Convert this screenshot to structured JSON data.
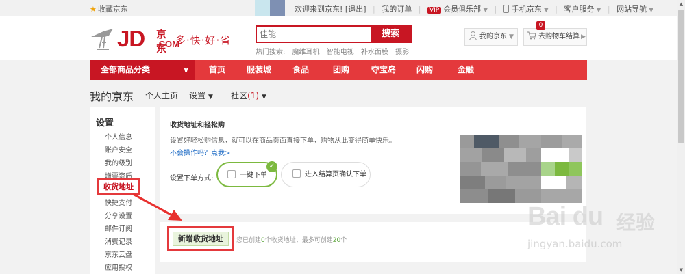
{
  "topbar": {
    "favorite": "收藏京东",
    "welcome": "欢迎来到京东! [退出]",
    "my_orders": "我的订单",
    "vip_badge": "VIP",
    "vip_club": "会员俱乐部",
    "mobile": "手机京东",
    "customer_service": "客户服务",
    "site_nav": "网站导航"
  },
  "header": {
    "logo_jd": "JD",
    "logo_cn": "京东",
    "logo_com": ".COM",
    "slogan": "多·快·好·省",
    "search_placeholder": "佳能",
    "search_button": "搜索",
    "hot_label": "热门搜索:",
    "hot_items": [
      "魔维耳机",
      "智能电视",
      "补水面膜",
      "摄影"
    ],
    "my_jd": "我的京东",
    "cart_label": "去购物车结算",
    "cart_count": "0"
  },
  "nav": {
    "all_categories": "全部商品分类",
    "items": [
      "首页",
      "服装城",
      "食品",
      "团购",
      "夺宝岛",
      "闪购",
      "金融"
    ]
  },
  "page": {
    "title": "我的京东",
    "links": [
      "个人主页",
      "设置",
      "社区"
    ],
    "community_count": "(1)"
  },
  "sidebar": {
    "heading": "设置",
    "items": [
      "个人信息",
      "账户安全",
      "我的级别",
      "增票资质",
      "收货地址",
      "快捷支付",
      "分享设置",
      "邮件订阅",
      "消费记录",
      "京东云盘",
      "应用授权"
    ],
    "active_index": 4
  },
  "panel": {
    "title": "收货地址和轻松购",
    "description": "设置好轻松购信息，就可以在商品页面直接下单，购物从此变得简单快乐。",
    "help_link": "不会操作吗？点我>",
    "order_mode_label": "设置下单方式:",
    "option_one_click": "一键下单",
    "option_checkout": "进入结算页确认下单"
  },
  "address": {
    "add_button": "新增收货地址",
    "info_prefix": "您已创建",
    "created_count": "0",
    "info_middle": "个收货地址，最多可创建",
    "max_count": "20",
    "info_suffix": "个"
  },
  "watermark": {
    "brand": "Bai du",
    "brand_cn": "经验",
    "url": "jingyan.baidu.com"
  },
  "colors": {
    "brand_red": "#c81623",
    "nav_red": "#e4393c",
    "accent_green": "#7cb93f",
    "link_blue": "#1e6bc5"
  }
}
